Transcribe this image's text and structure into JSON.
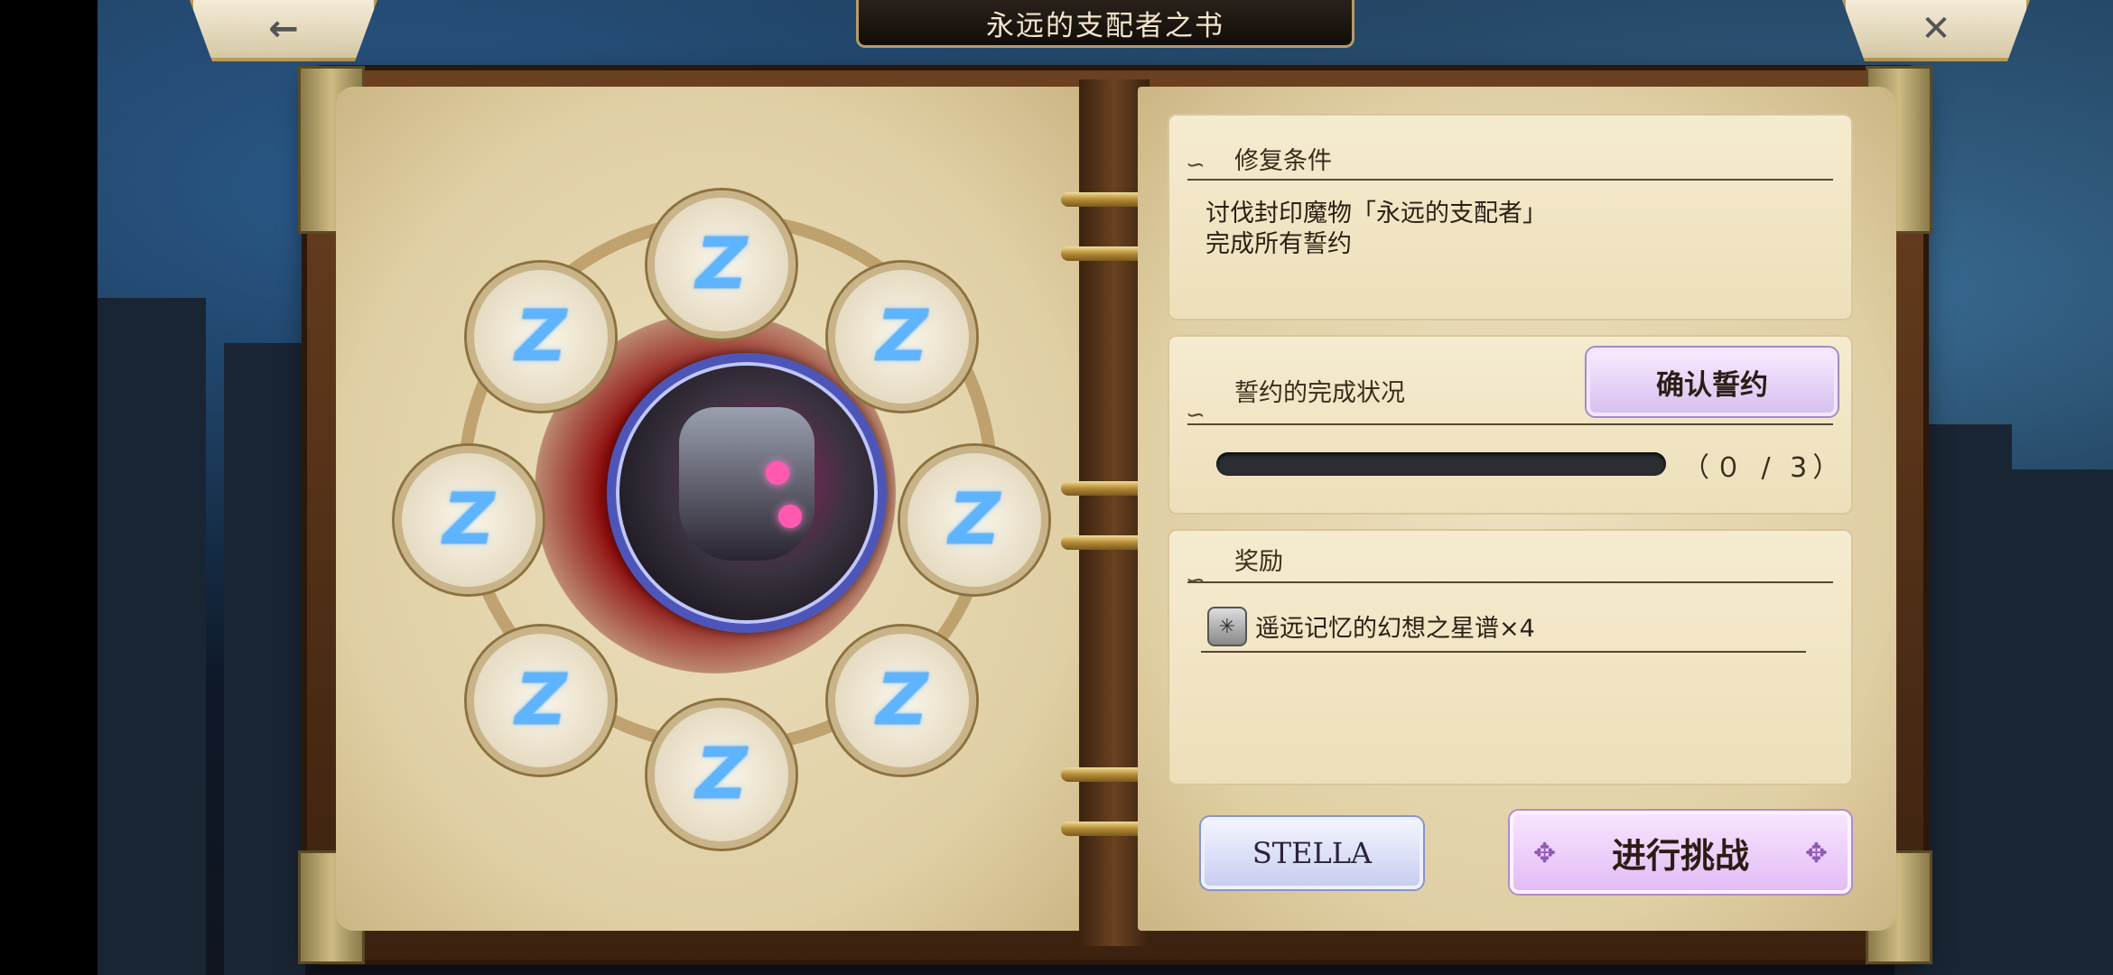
{
  "header": {
    "title": "永远的支配者之书",
    "back_icon": "←",
    "close_icon": "✕"
  },
  "seals": [
    "Z",
    "Z",
    "Z",
    "Z",
    "Z",
    "Z",
    "Z",
    "Z"
  ],
  "repair": {
    "heading": "修复条件",
    "line1": "讨伐封印魔物「永远的支配者」",
    "line2": "完成所有誓约"
  },
  "vow": {
    "heading": "誓约的完成状况",
    "check_button": "确认誓约",
    "progress_text": "（０ / 3）",
    "progress_value": 0,
    "progress_max": 3
  },
  "reward": {
    "heading": "奖励",
    "item": "遥远记忆的幻想之星谱×4"
  },
  "buttons": {
    "stella": "STELLA",
    "challenge": "进行挑战"
  },
  "colors": {
    "seal_glow": "#5fb4ff",
    "boss_accent": "#ff5ab0",
    "magic_red": "#c41a1a"
  }
}
